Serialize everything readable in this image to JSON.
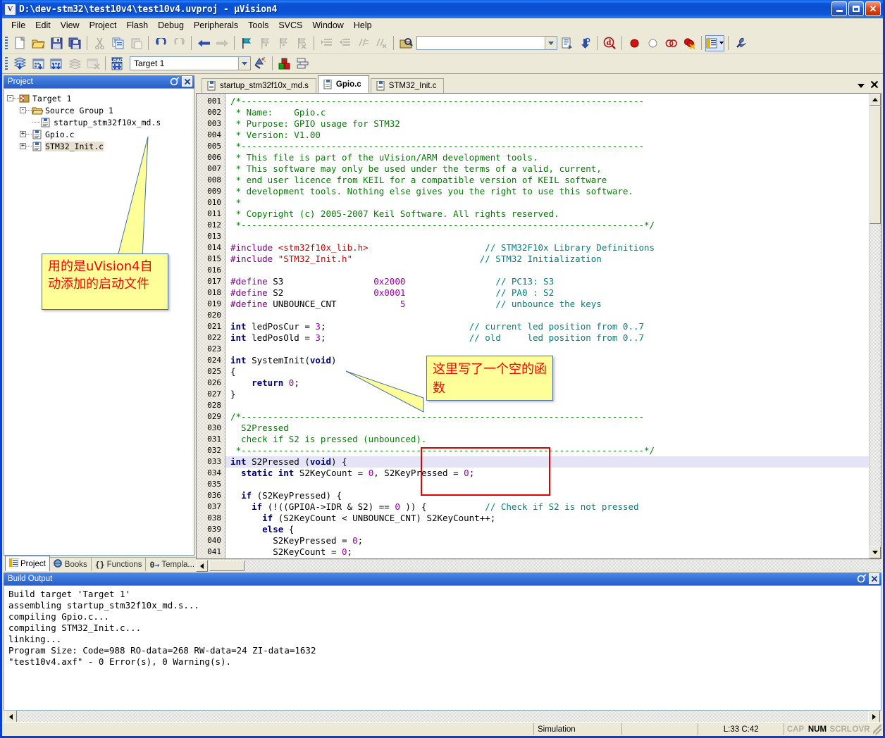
{
  "window": {
    "title": "D:\\dev-stm32\\test10v4\\test10v4.uvproj - µVision4",
    "icon": "uvision-logo-icon",
    "minimize_label": "Minimize",
    "maximize_label": "Maximize",
    "close_label": "Close"
  },
  "menubar": [
    {
      "label": "File"
    },
    {
      "label": "Edit"
    },
    {
      "label": "View"
    },
    {
      "label": "Project"
    },
    {
      "label": "Flash"
    },
    {
      "label": "Debug"
    },
    {
      "label": "Peripherals"
    },
    {
      "label": "Tools"
    },
    {
      "label": "SVCS"
    },
    {
      "label": "Window"
    },
    {
      "label": "Help"
    }
  ],
  "toolbar_main": {
    "items": [
      {
        "name": "new-file-icon",
        "label": "New"
      },
      {
        "name": "open-file-icon",
        "label": "Open"
      },
      {
        "name": "save-icon",
        "label": "Save"
      },
      {
        "name": "save-all-icon",
        "label": "Save All"
      },
      {
        "name": "cut-icon",
        "label": "Cut"
      },
      {
        "name": "copy-icon",
        "label": "Copy"
      },
      {
        "name": "paste-icon",
        "label": "Paste"
      },
      {
        "name": "undo-icon",
        "label": "Undo"
      },
      {
        "name": "redo-icon",
        "label": "Redo"
      },
      {
        "name": "navigate-back-icon",
        "label": "Back"
      },
      {
        "name": "navigate-forward-icon",
        "label": "Forward"
      },
      {
        "name": "bookmark-toggle-icon",
        "label": "Insert/Remove Bookmark"
      },
      {
        "name": "bookmark-prev-icon",
        "label": "Previous Bookmark"
      },
      {
        "name": "bookmark-next-icon",
        "label": "Next Bookmark"
      },
      {
        "name": "bookmark-clear-icon",
        "label": "Clear All Bookmarks"
      },
      {
        "name": "indent-icon",
        "label": "Indent Selection"
      },
      {
        "name": "outdent-icon",
        "label": "Outdent Selection"
      },
      {
        "name": "comment-icon",
        "label": "Comment Selection"
      },
      {
        "name": "uncomment-icon",
        "label": "Uncomment Selection"
      },
      {
        "name": "find-in-files-icon",
        "label": "Find in Files"
      },
      {
        "name": "bookmark-list-icon",
        "label": "Bookmarks"
      },
      {
        "name": "find-next-icon",
        "label": "Find Next"
      },
      {
        "name": "start-debug-icon",
        "label": "Start/Stop Debug Session"
      },
      {
        "name": "breakpoint-icon",
        "label": "Insert/Remove Breakpoint"
      },
      {
        "name": "breakpoint-disable-icon",
        "label": "Enable/Disable Breakpoint"
      },
      {
        "name": "breakpoint-disable-all-icon",
        "label": "Disable All Breakpoints"
      },
      {
        "name": "breakpoint-kill-all-icon",
        "label": "Kill All Breakpoints"
      },
      {
        "name": "window-manager-icon",
        "label": "Manage Windows"
      },
      {
        "name": "config-wizard-icon",
        "label": "Configuration Wizard"
      }
    ],
    "search_placeholder": "",
    "search_value": ""
  },
  "toolbar_build": {
    "items": [
      {
        "name": "translate-file-icon",
        "label": "Translate Current File"
      },
      {
        "name": "build-target-icon",
        "label": "Build Target"
      },
      {
        "name": "rebuild-all-icon",
        "label": "Rebuild all target files"
      },
      {
        "name": "batch-build-icon",
        "label": "Batch Build"
      },
      {
        "name": "stop-build-icon",
        "label": "Stop Build"
      },
      {
        "name": "download-icon",
        "label": "Download"
      },
      {
        "name": "target-options-icon",
        "label": "Options for Target"
      },
      {
        "name": "manage-components-icon",
        "label": "Manage Components"
      }
    ],
    "target_value": "Target 1"
  },
  "project_pane": {
    "caption": "Project",
    "caption_buttons": [
      {
        "name": "auto-hide-icon",
        "label": "Auto Hide"
      },
      {
        "name": "close-pane-icon",
        "label": "Close"
      }
    ],
    "tree": [
      {
        "label": "Target 1",
        "icon": "target-icon",
        "expander": "-",
        "depth": 0
      },
      {
        "label": "Source Group 1",
        "icon": "folder-icon",
        "expander": "-",
        "depth": 1
      },
      {
        "label": "startup_stm32f10x_md.s",
        "icon": "source-file-icon",
        "expander": "",
        "depth": 2
      },
      {
        "label": "Gpio.c",
        "icon": "source-file-icon",
        "expander": "+",
        "depth": 2
      },
      {
        "label": "STM32_Init.c",
        "icon": "source-file-icon",
        "expander": "+",
        "depth": 2,
        "selected": true
      }
    ],
    "tabs": [
      {
        "label": "Project",
        "icon": "project-tab-icon",
        "active": true
      },
      {
        "label": "Books",
        "icon": "books-tab-icon",
        "active": false
      },
      {
        "label": "Functions",
        "icon": "functions-tab-icon",
        "active": false
      },
      {
        "label": "Templa...",
        "icon": "templates-tab-icon",
        "active": false
      }
    ]
  },
  "editor": {
    "tabs": [
      {
        "label": "startup_stm32f10x_md.s",
        "active": false
      },
      {
        "label": "Gpio.c",
        "active": true
      },
      {
        "label": "STM32_Init.c",
        "active": false
      }
    ],
    "tab_tools": [
      {
        "name": "tab-list-dropdown-icon",
        "label": "Window List"
      },
      {
        "name": "close-document-icon",
        "label": "Close Document"
      }
    ],
    "current_line_number": 33,
    "lines": [
      {
        "n": "001",
        "tokens": [
          {
            "t": "/*----------------------------------------------------------------------------",
            "c": "cmt"
          }
        ]
      },
      {
        "n": "002",
        "tokens": [
          {
            "t": " * Name:    Gpio.c",
            "c": "cmt"
          }
        ]
      },
      {
        "n": "003",
        "tokens": [
          {
            "t": " * Purpose: GPIO usage for STM32",
            "c": "cmt"
          }
        ]
      },
      {
        "n": "004",
        "tokens": [
          {
            "t": " * Version: V1.00",
            "c": "cmt"
          }
        ]
      },
      {
        "n": "005",
        "tokens": [
          {
            "t": " *----------------------------------------------------------------------------",
            "c": "cmt"
          }
        ]
      },
      {
        "n": "006",
        "tokens": [
          {
            "t": " * This file is part of the uVision/ARM development tools.",
            "c": "cmt"
          }
        ]
      },
      {
        "n": "007",
        "tokens": [
          {
            "t": " * This software may only be used under the terms of a valid, current,",
            "c": "cmt"
          }
        ]
      },
      {
        "n": "008",
        "tokens": [
          {
            "t": " * end user licence from KEIL for a compatible version of KEIL software",
            "c": "cmt"
          }
        ]
      },
      {
        "n": "009",
        "tokens": [
          {
            "t": " * development tools. Nothing else gives you the right to use this software.",
            "c": "cmt"
          }
        ]
      },
      {
        "n": "010",
        "tokens": [
          {
            "t": " *",
            "c": "cmt"
          }
        ]
      },
      {
        "n": "011",
        "tokens": [
          {
            "t": " * Copyright (c) 2005-2007 Keil Software. All rights reserved.",
            "c": "cmt"
          }
        ]
      },
      {
        "n": "012",
        "tokens": [
          {
            "t": " *----------------------------------------------------------------------------*/",
            "c": "cmt"
          }
        ]
      },
      {
        "n": "013",
        "tokens": []
      },
      {
        "n": "014",
        "tokens": [
          {
            "t": "#include ",
            "c": "pre"
          },
          {
            "t": "<stm32f10x_lib.h>",
            "c": "str"
          },
          {
            "t": "                      ",
            "c": "plain"
          },
          {
            "t": "// STM32F10x Library Definitions",
            "c": "lcmt"
          }
        ]
      },
      {
        "n": "015",
        "tokens": [
          {
            "t": "#include ",
            "c": "pre"
          },
          {
            "t": "\"STM32_Init.h\"",
            "c": "str"
          },
          {
            "t": "                        ",
            "c": "plain"
          },
          {
            "t": "// STM32 Initialization",
            "c": "lcmt"
          }
        ]
      },
      {
        "n": "016",
        "tokens": []
      },
      {
        "n": "017",
        "tokens": [
          {
            "t": "#define ",
            "c": "pre"
          },
          {
            "t": "S3                 ",
            "c": "plain"
          },
          {
            "t": "0x2000",
            "c": "num"
          },
          {
            "t": "                 ",
            "c": "plain"
          },
          {
            "t": "// PC13: S3",
            "c": "lcmt"
          }
        ]
      },
      {
        "n": "018",
        "tokens": [
          {
            "t": "#define ",
            "c": "pre"
          },
          {
            "t": "S2                 ",
            "c": "plain"
          },
          {
            "t": "0x0001",
            "c": "num"
          },
          {
            "t": "                 ",
            "c": "plain"
          },
          {
            "t": "// PA0 : S2",
            "c": "lcmt"
          }
        ]
      },
      {
        "n": "019",
        "tokens": [
          {
            "t": "#define ",
            "c": "pre"
          },
          {
            "t": "UNBOUNCE_CNT            ",
            "c": "plain"
          },
          {
            "t": "5",
            "c": "num"
          },
          {
            "t": "                 ",
            "c": "plain"
          },
          {
            "t": "// unbounce the keys",
            "c": "lcmt"
          }
        ]
      },
      {
        "n": "020",
        "tokens": []
      },
      {
        "n": "021",
        "tokens": [
          {
            "t": "int",
            "c": "kw"
          },
          {
            "t": " ledPosCur = ",
            "c": "plain"
          },
          {
            "t": "3",
            "c": "num"
          },
          {
            "t": ";",
            "c": "plain"
          },
          {
            "t": "                           ",
            "c": "plain"
          },
          {
            "t": "// current led position from 0..7",
            "c": "lcmt"
          }
        ]
      },
      {
        "n": "022",
        "tokens": [
          {
            "t": "int",
            "c": "kw"
          },
          {
            "t": " ledPosOld = ",
            "c": "plain"
          },
          {
            "t": "3",
            "c": "num"
          },
          {
            "t": ";",
            "c": "plain"
          },
          {
            "t": "                           ",
            "c": "plain"
          },
          {
            "t": "// old     led position from 0..7",
            "c": "lcmt"
          }
        ]
      },
      {
        "n": "023",
        "tokens": []
      },
      {
        "n": "024",
        "tokens": [
          {
            "t": "int",
            "c": "kw"
          },
          {
            "t": " SystemInit(",
            "c": "plain"
          },
          {
            "t": "void",
            "c": "kw"
          },
          {
            "t": ")",
            "c": "plain"
          }
        ]
      },
      {
        "n": "025",
        "tokens": [
          {
            "t": "{",
            "c": "plain"
          }
        ]
      },
      {
        "n": "026",
        "tokens": [
          {
            "t": "    ",
            "c": "plain"
          },
          {
            "t": "return",
            "c": "kw"
          },
          {
            "t": " ",
            "c": "plain"
          },
          {
            "t": "0",
            "c": "num"
          },
          {
            "t": ";",
            "c": "plain"
          }
        ]
      },
      {
        "n": "027",
        "tokens": [
          {
            "t": "}",
            "c": "plain"
          }
        ]
      },
      {
        "n": "028",
        "tokens": []
      },
      {
        "n": "029",
        "tokens": [
          {
            "t": "/*----------------------------------------------------------------------------",
            "c": "cmt"
          }
        ]
      },
      {
        "n": "030",
        "tokens": [
          {
            "t": "  S2Pressed",
            "c": "cmt"
          }
        ]
      },
      {
        "n": "031",
        "tokens": [
          {
            "t": "  check if S2 is pressed (unbounced).",
            "c": "cmt"
          }
        ]
      },
      {
        "n": "032",
        "tokens": [
          {
            "t": " *----------------------------------------------------------------------------*/",
            "c": "cmt"
          }
        ]
      },
      {
        "n": "033",
        "hl": true,
        "tokens": [
          {
            "t": "int",
            "c": "kw"
          },
          {
            "t": " S2Pressed (",
            "c": "plain"
          },
          {
            "t": "void",
            "c": "kw"
          },
          {
            "t": ") {",
            "c": "plain"
          }
        ]
      },
      {
        "n": "034",
        "tokens": [
          {
            "t": "  ",
            "c": "plain"
          },
          {
            "t": "static int",
            "c": "kw"
          },
          {
            "t": " S2KeyCount = ",
            "c": "plain"
          },
          {
            "t": "0",
            "c": "num"
          },
          {
            "t": ", S2KeyPressed = ",
            "c": "plain"
          },
          {
            "t": "0",
            "c": "num"
          },
          {
            "t": ";",
            "c": "plain"
          }
        ]
      },
      {
        "n": "035",
        "tokens": []
      },
      {
        "n": "036",
        "tokens": [
          {
            "t": "  ",
            "c": "plain"
          },
          {
            "t": "if",
            "c": "kw"
          },
          {
            "t": " (S2KeyPressed) {",
            "c": "plain"
          }
        ]
      },
      {
        "n": "037",
        "tokens": [
          {
            "t": "    ",
            "c": "plain"
          },
          {
            "t": "if",
            "c": "kw"
          },
          {
            "t": " (!((GPIOA->IDR & S2) == ",
            "c": "plain"
          },
          {
            "t": "0",
            "c": "num"
          },
          {
            "t": " )) {",
            "c": "plain"
          },
          {
            "t": "           ",
            "c": "plain"
          },
          {
            "t": "// Check if S2 is not pressed",
            "c": "lcmt"
          }
        ]
      },
      {
        "n": "038",
        "tokens": [
          {
            "t": "      ",
            "c": "plain"
          },
          {
            "t": "if",
            "c": "kw"
          },
          {
            "t": " (S2KeyCount < UNBOUNCE_CNT) S2KeyCount++;",
            "c": "plain"
          }
        ]
      },
      {
        "n": "039",
        "tokens": [
          {
            "t": "      ",
            "c": "plain"
          },
          {
            "t": "else",
            "c": "kw"
          },
          {
            "t": " {",
            "c": "plain"
          }
        ]
      },
      {
        "n": "040",
        "tokens": [
          {
            "t": "        S2KeyPressed = ",
            "c": "plain"
          },
          {
            "t": "0",
            "c": "num"
          },
          {
            "t": ";",
            "c": "plain"
          }
        ]
      },
      {
        "n": "041",
        "tokens": [
          {
            "t": "        S2KeyCount = ",
            "c": "plain"
          },
          {
            "t": "0",
            "c": "num"
          },
          {
            "t": ";",
            "c": "plain"
          }
        ]
      }
    ]
  },
  "build_output": {
    "caption": "Build Output",
    "caption_buttons": [
      {
        "name": "auto-hide-icon",
        "label": "Auto Hide"
      },
      {
        "name": "close-pane-icon",
        "label": "Close"
      }
    ],
    "text": "Build target 'Target 1'\nassembling startup_stm32f10x_md.s...\ncompiling Gpio.c...\ncompiling STM32_Init.c...\nlinking...\nProgram Size: Code=988 RO-data=268 RW-data=24 ZI-data=1632\n\"test10v4.axf\" - 0 Error(s), 0 Warning(s)."
  },
  "statusbar": {
    "mode": "Simulation",
    "position": "L:33 C:42",
    "indicators": [
      {
        "label": "CAP",
        "on": false
      },
      {
        "label": "NUM",
        "on": true
      },
      {
        "label": "SCRL",
        "on": false
      },
      {
        "label": "OVR",
        "on": false
      }
    ]
  },
  "annotations": [
    {
      "id": "callout-1",
      "text": "用的是uVision4自动添加的启动文件",
      "color": "#ff0000",
      "bg": "#ffff99"
    },
    {
      "id": "callout-2",
      "text": "这里写了一个空的函数",
      "color": "#ff0000",
      "bg": "#ffff99"
    }
  ],
  "highlight_box": {
    "name": "system-init-highlight",
    "color": "#e00000"
  }
}
